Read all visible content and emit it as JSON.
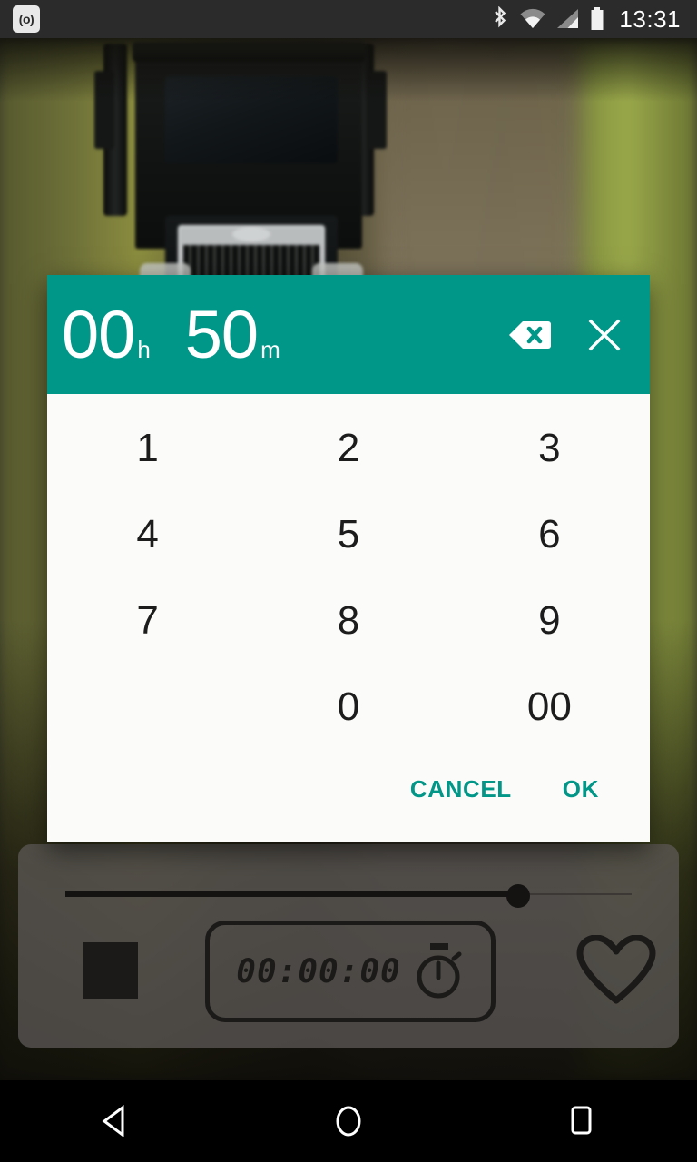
{
  "status_bar": {
    "notification_icon": "cast-screen-icon",
    "notification_glyph": "(o)",
    "icons": [
      "bluetooth-icon",
      "wifi-icon",
      "cellular-signal-icon",
      "battery-icon"
    ],
    "clock": "13:31",
    "background_color": "#2b2b2b"
  },
  "wallpaper": {
    "description": "semi-truck driving on dirt road",
    "subject": "truck"
  },
  "picker": {
    "accent_color": "#009688",
    "header": {
      "hours_value": "00",
      "hours_unit": "h",
      "minutes_value": "50",
      "minutes_unit": "m",
      "backspace_icon": "backspace-icon",
      "close_icon": "close-icon"
    },
    "keys": [
      {
        "label": "1",
        "value": "1"
      },
      {
        "label": "2",
        "value": "2"
      },
      {
        "label": "3",
        "value": "3"
      },
      {
        "label": "4",
        "value": "4"
      },
      {
        "label": "5",
        "value": "5"
      },
      {
        "label": "6",
        "value": "6"
      },
      {
        "label": "7",
        "value": "7"
      },
      {
        "label": "8",
        "value": "8"
      },
      {
        "label": "9",
        "value": "9"
      },
      {
        "label": "",
        "value": ""
      },
      {
        "label": "0",
        "value": "0"
      },
      {
        "label": "00",
        "value": "00"
      }
    ],
    "cancel_label": "CANCEL",
    "ok_label": "OK"
  },
  "player": {
    "seek_position_percent": 80,
    "stop_icon": "stop-square-icon",
    "timer_value": "00:00:00",
    "timer_icon": "stopwatch-icon",
    "favorite_icon": "heart-outline-icon"
  },
  "nav_bar": {
    "back_icon": "back-triangle-icon",
    "home_icon": "home-circle-icon",
    "recents_icon": "recents-square-icon"
  }
}
